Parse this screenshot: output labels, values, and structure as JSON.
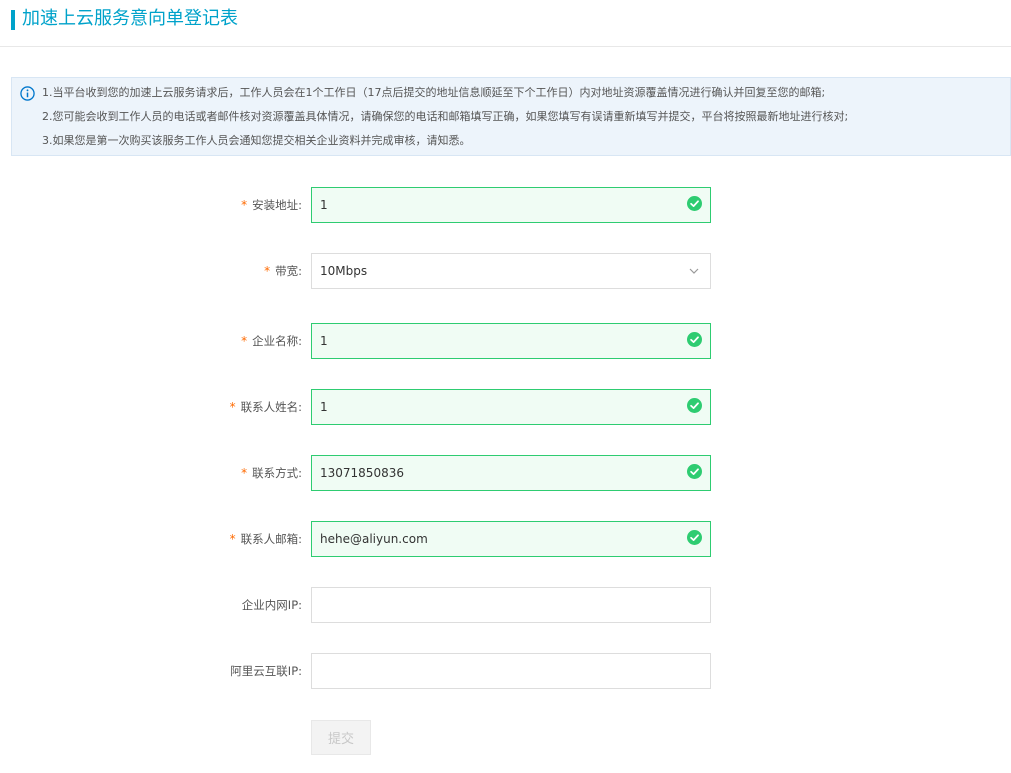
{
  "page": {
    "title": "加速上云服务意向单登记表"
  },
  "notice": {
    "icon": "info-icon",
    "lines": [
      "1.当平台收到您的加速上云服务请求后，工作人员会在1个工作日（17点后提交的地址信息顺延至下个工作日）内对地址资源覆盖情况进行确认并回复至您的邮箱;",
      "2.您可能会收到工作人员的电话或者邮件核对资源覆盖具体情况，请确保您的电话和邮箱填写正确，如果您填写有误请重新填写并提交，平台将按照最新地址进行核对;",
      "3.如果您是第一次购买该服务工作人员会通知您提交相关企业资料并完成审核，请知悉。"
    ]
  },
  "form": {
    "required_mark": "*",
    "install_address": {
      "label": "安装地址:",
      "value": "1"
    },
    "bandwidth": {
      "label": "带宽:",
      "value": "10Mbps"
    },
    "company_name": {
      "label": "企业名称:",
      "value": "1"
    },
    "contact_name": {
      "label": "联系人姓名:",
      "value": "1"
    },
    "contact_phone": {
      "label": "联系方式:",
      "value": "13071850836"
    },
    "contact_email": {
      "label": "联系人邮箱:",
      "value": "hehe@aliyun.com"
    },
    "intranet_ip": {
      "label": "企业内网IP:",
      "value": ""
    },
    "interconnect_ip": {
      "label": "阿里云互联IP:",
      "value": ""
    },
    "submit_label": "提交"
  },
  "colors": {
    "accent": "#00a2ca",
    "required": "#ff6a00",
    "valid": "#2ecc71",
    "notice_bg": "#edf4fb"
  }
}
